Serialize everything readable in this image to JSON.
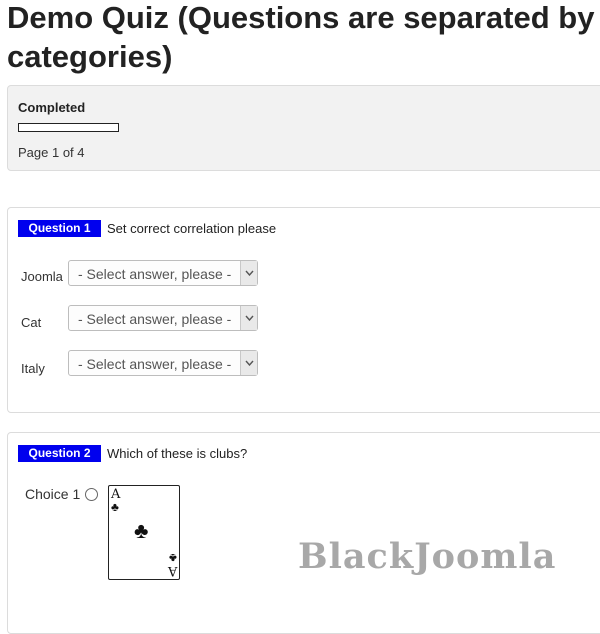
{
  "page": {
    "title": "Demo Quiz (Questions are separated by categories)"
  },
  "status": {
    "completed_label": "Completed",
    "progress": 0,
    "page_indicator": "Page 1 of 4"
  },
  "question1": {
    "badge": "Question 1",
    "text": "Set correct correlation please",
    "rows": [
      {
        "label": "Joomla",
        "select": "- Select answer, please -"
      },
      {
        "label": "Cat",
        "select": "- Select answer, please -"
      },
      {
        "label": "Italy",
        "select": "- Select answer, please -"
      }
    ]
  },
  "question2": {
    "badge": "Question 2",
    "text": "Which of these is clubs?",
    "choice_label": "Choice 1",
    "card_rank": "A",
    "card_suit": "♣"
  },
  "watermark": "BlackJoomla",
  "icons": {
    "dropdown": "chevron-down-icon",
    "radio": "radio-icon"
  },
  "colors": {
    "badge": "#0000ee",
    "panel": "#f2f2f2"
  }
}
